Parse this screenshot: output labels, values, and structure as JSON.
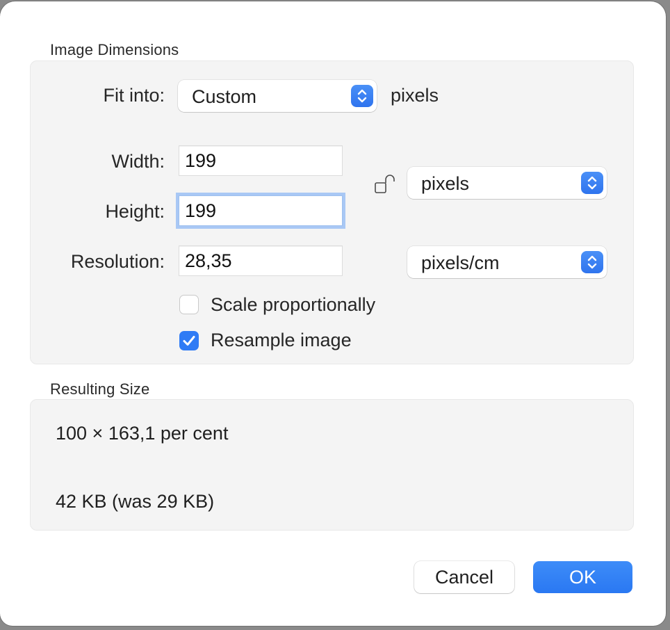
{
  "image_dimensions": {
    "group_title": "Image Dimensions",
    "fit_into": {
      "label": "Fit into:",
      "value": "Custom",
      "unit": "pixels"
    },
    "width": {
      "label": "Width:",
      "value": "199"
    },
    "height": {
      "label": "Height:",
      "value": "199"
    },
    "resolution": {
      "label": "Resolution:",
      "value": "28,35"
    },
    "size_unit": "pixels",
    "resolution_unit": "pixels/cm",
    "lock_icon": "unlocked-padlock-icon",
    "scale_proportionally": {
      "label": "Scale proportionally",
      "checked": false
    },
    "resample_image": {
      "label": "Resample image",
      "checked": true
    }
  },
  "resulting_size": {
    "group_title": "Resulting Size",
    "percentage": "100 × 163,1 per cent",
    "file_size": "42 KB (was 29 KB)"
  },
  "buttons": {
    "cancel": "Cancel",
    "ok": "OK"
  },
  "colors": {
    "accent": "#2f7bf5",
    "panel": "#f4f4f4",
    "focus_ring": "#a9c8f5"
  }
}
